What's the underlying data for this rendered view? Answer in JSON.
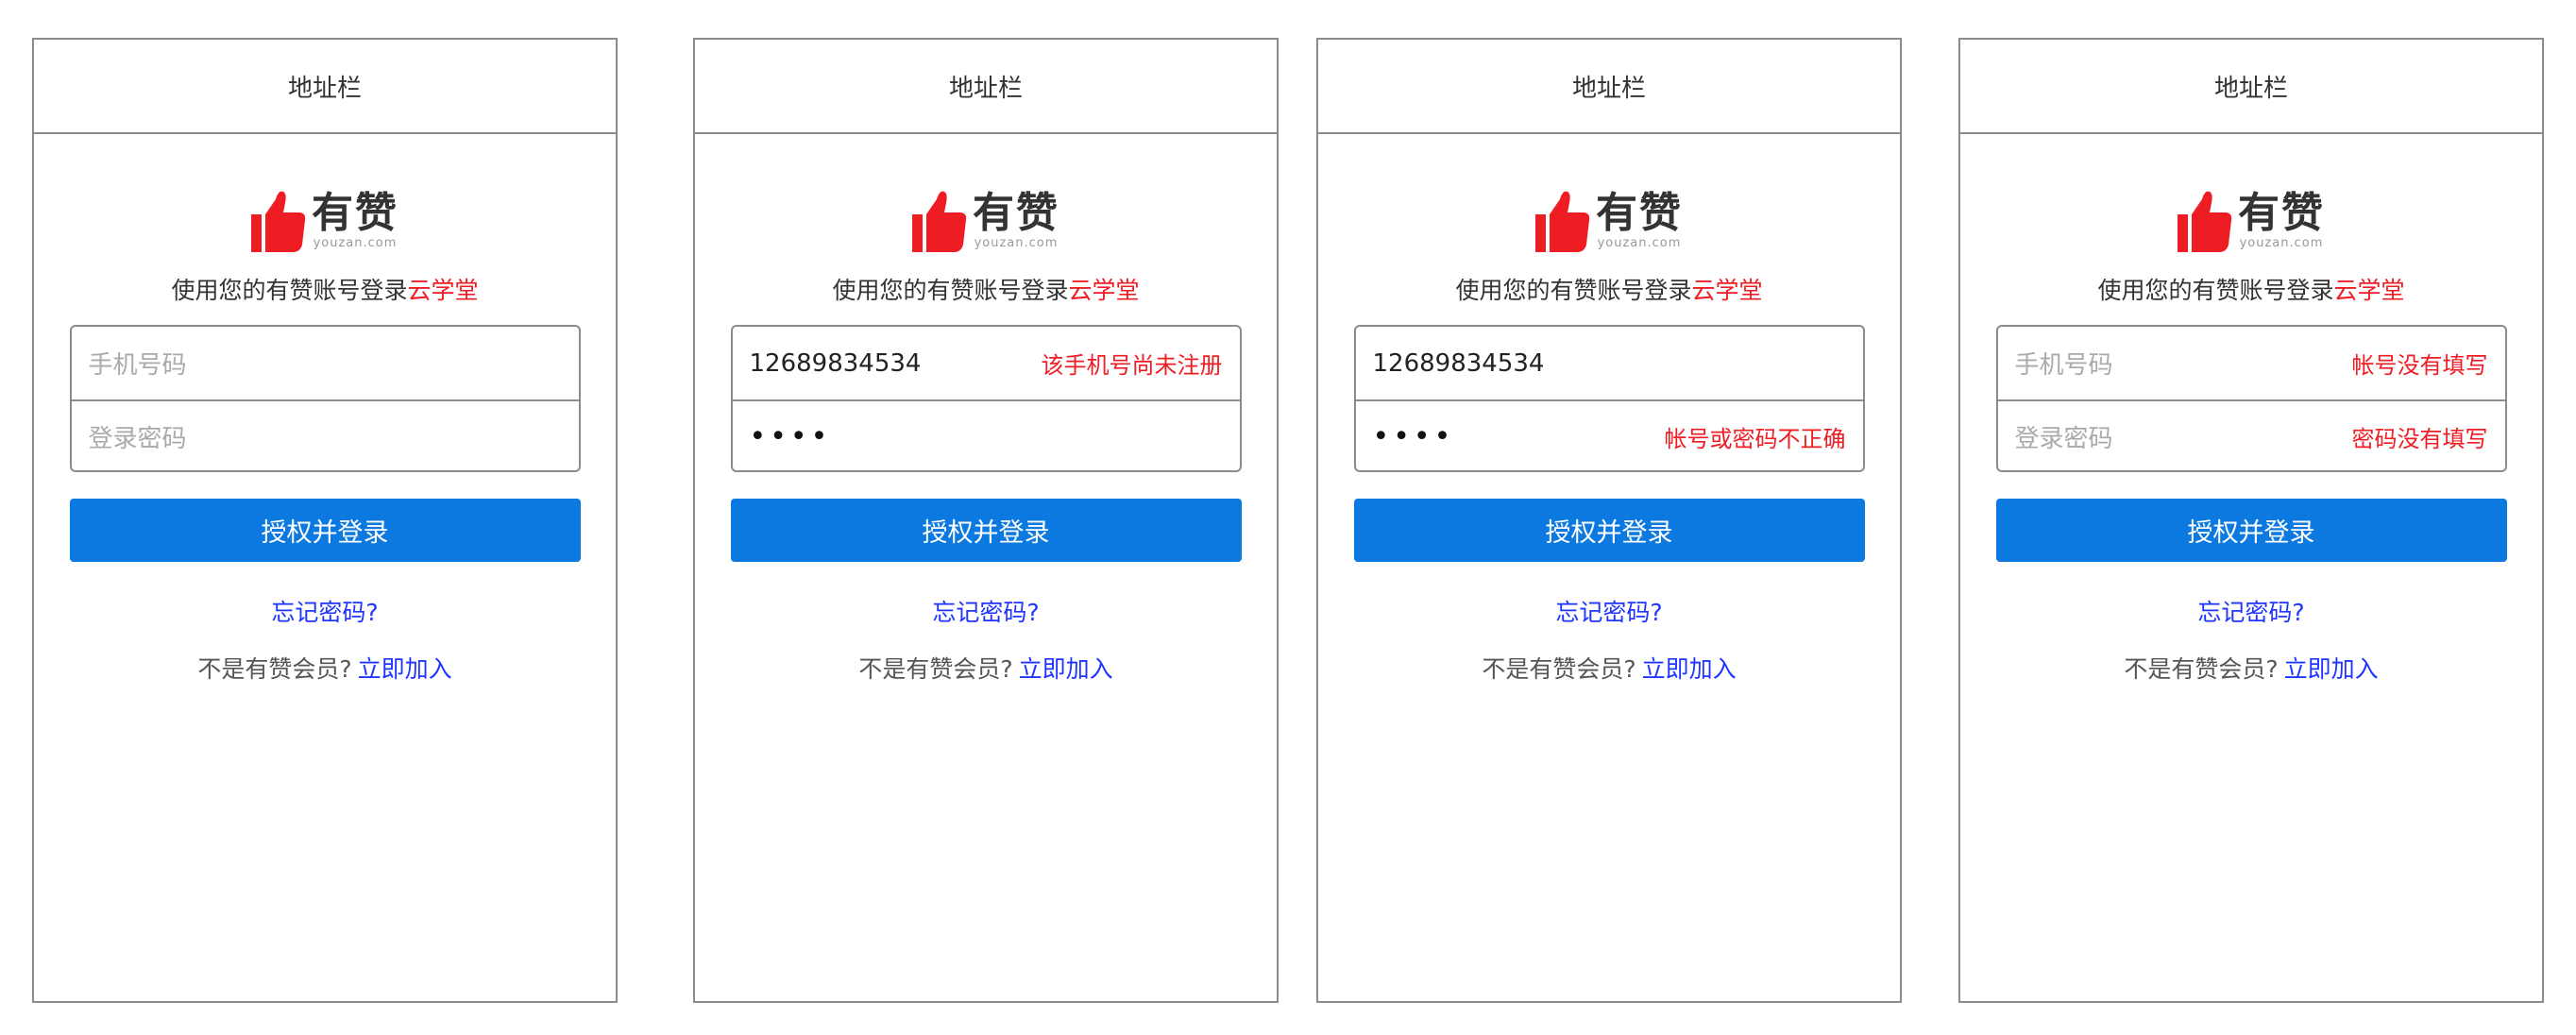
{
  "brand": {
    "name": "有赞",
    "domain": "youzan.com"
  },
  "colors": {
    "accent": "#ee1d24",
    "button": "#0b79df",
    "link": "#1f35ff"
  },
  "frames": [
    {
      "address_bar": "地址栏",
      "subtitle_prefix": "使用您的有赞账号登录",
      "subtitle_accent": "云学堂",
      "phone_placeholder": "手机号码",
      "phone_value": "",
      "phone_error": "",
      "password_placeholder": "登录密码",
      "password_value": "",
      "password_error": "",
      "submit_label": "授权并登录",
      "forgot_label": "忘记密码?",
      "join_prompt": "不是有赞会员?",
      "join_link": "立即加入"
    },
    {
      "address_bar": "地址栏",
      "subtitle_prefix": "使用您的有赞账号登录",
      "subtitle_accent": "云学堂",
      "phone_placeholder": "",
      "phone_value": "12689834534",
      "phone_error": "该手机号尚未注册",
      "password_placeholder": "",
      "password_value": "••••",
      "password_error": "",
      "submit_label": "授权并登录",
      "forgot_label": "忘记密码?",
      "join_prompt": "不是有赞会员?",
      "join_link": "立即加入"
    },
    {
      "address_bar": "地址栏",
      "subtitle_prefix": "使用您的有赞账号登录",
      "subtitle_accent": "云学堂",
      "phone_placeholder": "",
      "phone_value": "12689834534",
      "phone_error": "",
      "password_placeholder": "",
      "password_value": "••••",
      "password_error": "帐号或密码不正确",
      "submit_label": "授权并登录",
      "forgot_label": "忘记密码?",
      "join_prompt": "不是有赞会员?",
      "join_link": "立即加入"
    },
    {
      "address_bar": "地址栏",
      "subtitle_prefix": "使用您的有赞账号登录",
      "subtitle_accent": "云学堂",
      "phone_placeholder": "手机号码",
      "phone_value": "",
      "phone_error": "帐号没有填写",
      "password_placeholder": "登录密码",
      "password_value": "",
      "password_error": "密码没有填写",
      "submit_label": "授权并登录",
      "forgot_label": "忘记密码?",
      "join_prompt": "不是有赞会员?",
      "join_link": "立即加入"
    }
  ]
}
